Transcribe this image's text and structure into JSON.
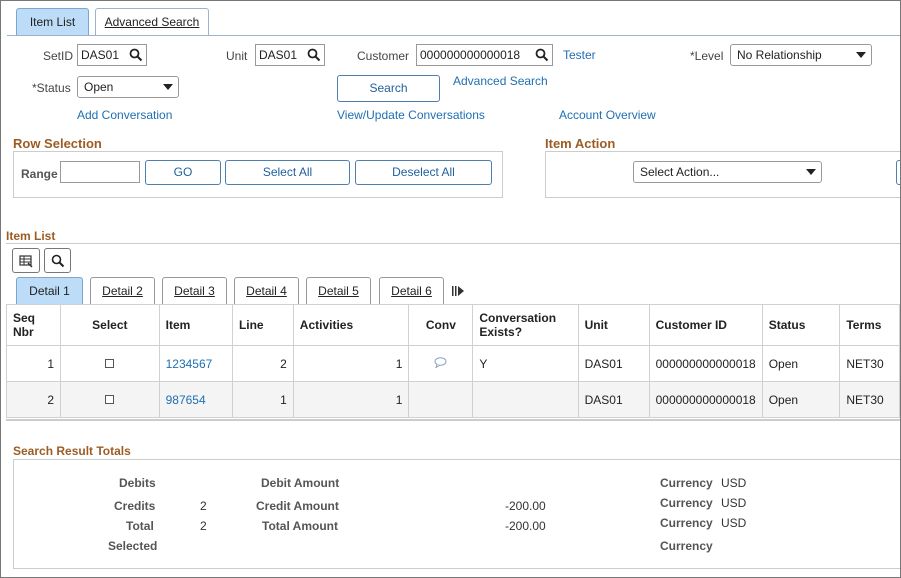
{
  "tabs": {
    "item_list": "Item List",
    "advanced_search": "Advanced Search"
  },
  "criteria": {
    "setid_label": "SetID",
    "setid_value": "DAS01",
    "unit_label": "Unit",
    "unit_value": "DAS01",
    "customer_label": "Customer",
    "customer_value": "000000000000018",
    "customer_name": "Tester",
    "level_label": "*Level",
    "level_value": "No Relationship",
    "status_label": "*Status",
    "status_value": "Open",
    "search_button": "Search",
    "advanced_search_link": "Advanced Search",
    "add_conversation_link": "Add Conversation",
    "view_update_conversations_link": "View/Update Conversations",
    "account_overview_link": "Account Overview"
  },
  "row_selection": {
    "title": "Row Selection",
    "range_label": "Range",
    "range_value": "",
    "go_button": "GO",
    "select_all_button": "Select All",
    "deselect_all_button": "Deselect All"
  },
  "item_action": {
    "title": "Item Action",
    "select_value": "Select Action..."
  },
  "item_list": {
    "title": "Item List",
    "tabs": [
      "Detail 1",
      "Detail 2",
      "Detail 3",
      "Detail 4",
      "Detail 5",
      "Detail 6"
    ],
    "columns": {
      "seq": "Seq",
      "nbr": "Nbr",
      "select": "Select",
      "item": "Item",
      "line": "Line",
      "activities": "Activities",
      "conv": "Conv",
      "conv_exists_1": "Conversation",
      "conv_exists_2": "Exists?",
      "unit": "Unit",
      "customer_id": "Customer ID",
      "status": "Status",
      "terms": "Terms"
    },
    "rows": [
      {
        "seq": "1",
        "item": "1234567",
        "line": "2",
        "activities": "1",
        "conv_exists": "Y",
        "unit": "DAS01",
        "customer_id": "000000000000018",
        "status": "Open",
        "terms": "NET30"
      },
      {
        "seq": "2",
        "item": "987654",
        "line": "1",
        "activities": "1",
        "conv_exists": "",
        "unit": "DAS01",
        "customer_id": "000000000000018",
        "status": "Open",
        "terms": "NET30"
      }
    ]
  },
  "totals": {
    "title": "Search Result Totals",
    "debits_label": "Debits",
    "debits_count": "",
    "debit_amount_label": "Debit Amount",
    "debit_amount": "",
    "credits_label": "Credits",
    "credits_count": "2",
    "credit_amount_label": "Credit Amount",
    "credit_amount": "-200.00",
    "total_label": "Total",
    "total_count": "2",
    "total_amount_label": "Total Amount",
    "total_amount": "-200.00",
    "selected_label": "Selected",
    "currency_label": "Currency",
    "currency_1": "USD",
    "currency_2": "USD",
    "currency_3": "USD",
    "currency_4": ""
  },
  "colors": {
    "accent": "#1f6fb2",
    "section_title": "#9c5c24",
    "active_tab": "#bcdcf7"
  }
}
